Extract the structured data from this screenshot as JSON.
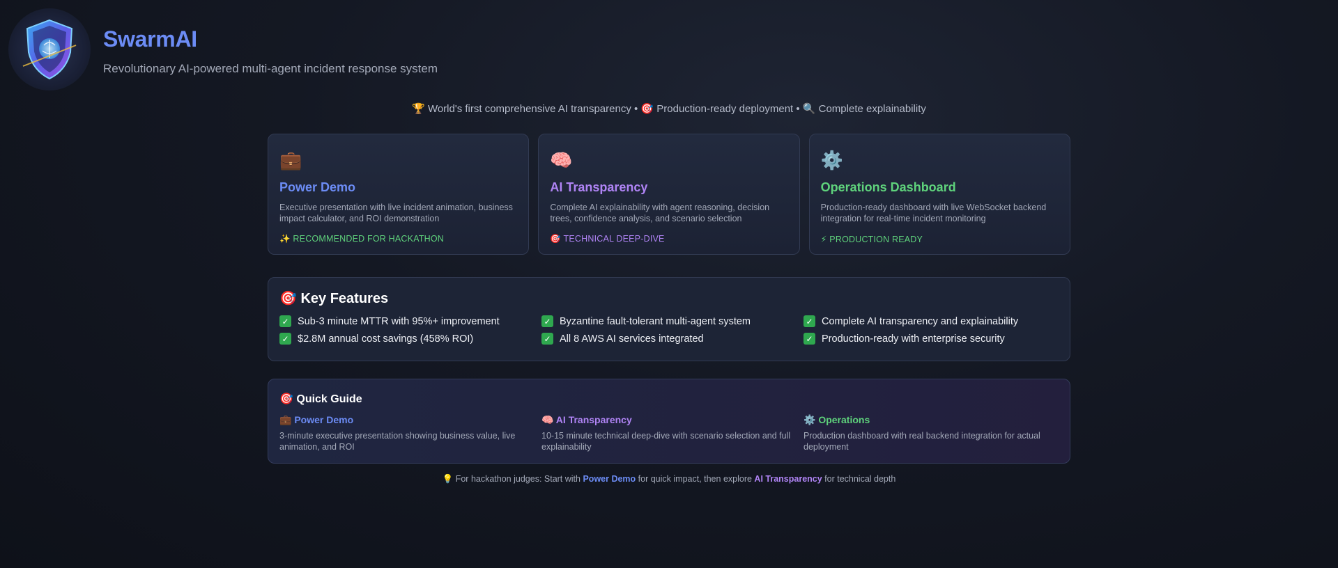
{
  "brand": {
    "title": "SwarmAI",
    "subtitle": "Revolutionary AI-powered multi-agent incident response system"
  },
  "tagline": "🏆 World's first comprehensive AI transparency • 🎯 Production-ready deployment • 🔍 Complete explainability",
  "cards": [
    {
      "icon": "💼",
      "icon_name": "briefcase-icon",
      "title": "Power Demo",
      "description": "Executive presentation with live incident animation, business impact calculator, and ROI demonstration",
      "badge": "✨ RECOMMENDED FOR HACKATHON",
      "color": "#6c8cf5"
    },
    {
      "icon": "🧠",
      "icon_name": "brain-icon",
      "title": "AI Transparency",
      "description": "Complete AI explainability with agent reasoning, decision trees, confidence analysis, and scenario selection",
      "badge": "🎯 TECHNICAL DEEP-DIVE",
      "color": "#b084f5"
    },
    {
      "icon": "⚙️",
      "icon_name": "gear-icon",
      "title": "Operations Dashboard",
      "description": "Production-ready dashboard with live WebSocket backend integration for real-time incident monitoring",
      "badge": "⚡ PRODUCTION READY",
      "color": "#5fd37c"
    }
  ],
  "features": {
    "title": "🎯 Key Features",
    "check_glyph": "✓",
    "items": [
      "Sub-3 minute MTTR with 95%+ improvement",
      "Byzantine fault-tolerant multi-agent system",
      "Complete AI transparency and explainability",
      "$2.8M annual cost savings (458% ROI)",
      "All 8 AWS AI services integrated",
      "Production-ready with enterprise security"
    ]
  },
  "guide": {
    "title": "🎯 Quick Guide",
    "items": [
      {
        "heading": "💼 Power Demo",
        "description": "3-minute executive presentation showing business value, live animation, and ROI"
      },
      {
        "heading": "🧠 AI Transparency",
        "description": "10-15 minute technical deep-dive with scenario selection and full explainability"
      },
      {
        "heading": "⚙️ Operations",
        "description": "Production dashboard with real backend integration for actual deployment"
      }
    ]
  },
  "footnote": {
    "prefix": "💡 For hackathon judges: Start with ",
    "link1": "Power Demo",
    "middle": " for quick impact, then explore ",
    "link2": "AI Transparency",
    "suffix": " for technical depth"
  }
}
